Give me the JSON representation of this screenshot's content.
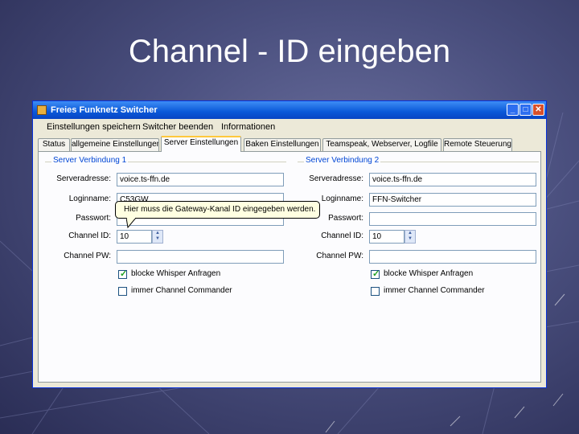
{
  "slide": {
    "title": "Channel - ID eingeben"
  },
  "window": {
    "title": "Freies Funknetz Switcher",
    "controls": {
      "minimize": "_",
      "maximize": "□",
      "close": "✕"
    }
  },
  "menu": {
    "items": [
      "Einstellungen speichern",
      "Switcher beenden",
      "Informationen"
    ]
  },
  "tabs": [
    {
      "label": "Status"
    },
    {
      "label": "allgemeine Einstellungen"
    },
    {
      "label": "Server Einstellungen"
    },
    {
      "label": "Baken Einstellungen"
    },
    {
      "label": "Teamspeak, Webserver, Logfile"
    },
    {
      "label": "Remote Steuerung"
    }
  ],
  "server1": {
    "group_label": "Server Verbindung 1",
    "labels": {
      "address": "Serveradresse:",
      "login": "Loginname:",
      "password": "Passwort:",
      "channel_id": "Channel ID:",
      "channel_pw": "Channel PW:"
    },
    "address": "voice.ts-ffn.de",
    "login": "C53GW",
    "password": "",
    "channel_id": "10",
    "channel_pw": "",
    "whisper_label": "blocke Whisper Anfragen",
    "whisper_checked": true,
    "commander_label": "immer Channel Commander",
    "commander_checked": false
  },
  "server2": {
    "group_label": "Server Verbindung 2",
    "labels": {
      "address": "Serveradresse:",
      "login": "Loginname:",
      "password": "Passwort:",
      "channel_id": "Channel ID:",
      "channel_pw": "Channel PW:"
    },
    "address": "voice.ts-ffn.de",
    "login": "FFN-Switcher",
    "password": "",
    "channel_id": "10",
    "channel_pw": "",
    "whisper_label": "blocke Whisper Anfragen",
    "whisper_checked": true,
    "commander_label": "immer Channel Commander",
    "commander_checked": false
  },
  "tooltip": {
    "text": "Hier muss die Gateway-Kanal ID eingegeben werden."
  },
  "icons": {
    "spin_up": "▲",
    "spin_down": "▼",
    "check": "✓"
  },
  "colors": {
    "titlebar": "#0a58d8",
    "tab_highlight": "#ffc83c",
    "group_label": "#0046d5",
    "tooltip_bg": "#ffffe1"
  }
}
